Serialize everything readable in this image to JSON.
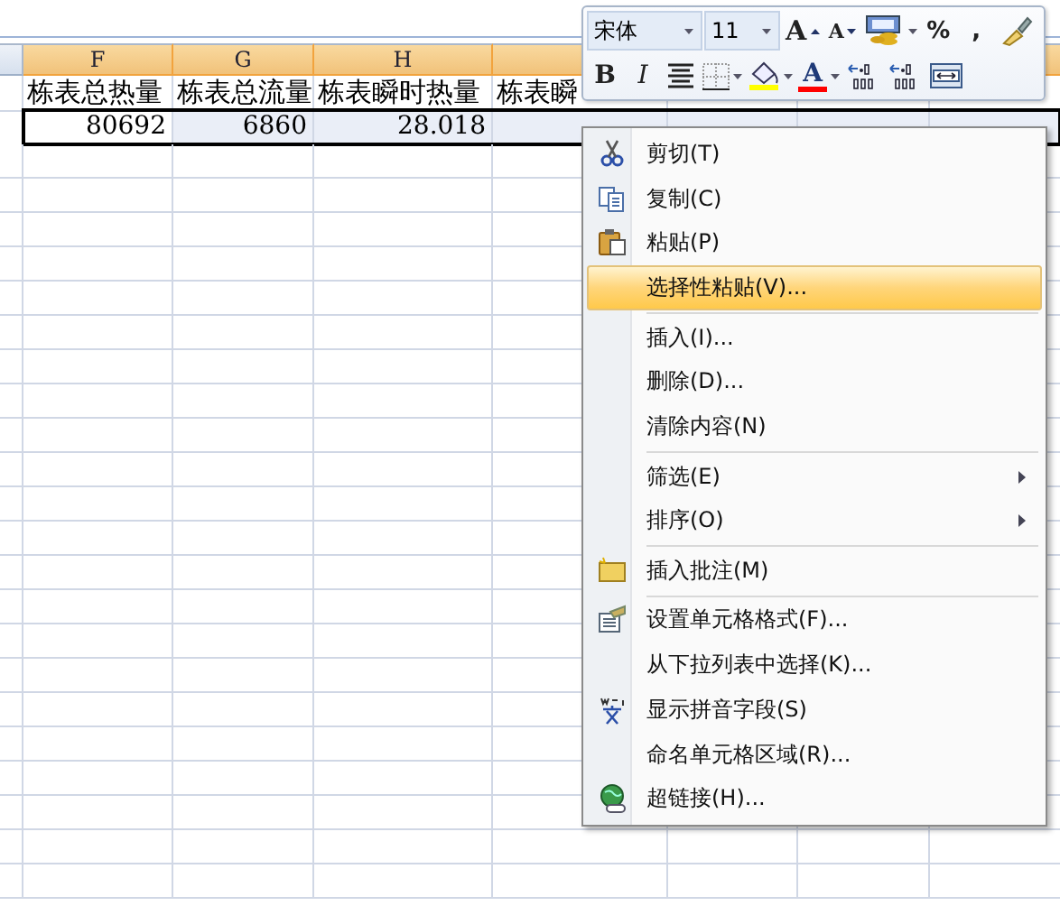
{
  "sheet": {
    "columns": [
      {
        "selected": false
      },
      {
        "letter": "F",
        "selected": true
      },
      {
        "letter": "G",
        "selected": true
      },
      {
        "letter": "H",
        "selected": true
      },
      {
        "selected": true
      },
      {
        "selected": true
      }
    ],
    "rows": [
      [
        null,
        "栋表总热量",
        "栋表总流量",
        "栋表瞬时热量",
        "栋表瞬",
        null
      ],
      [
        null,
        "80692",
        "6860",
        "28.018",
        null,
        null
      ]
    ]
  },
  "mini_toolbar": {
    "rows": [
      [
        {
          "kind": "font-field",
          "value": "宋体"
        },
        {
          "kind": "size-field",
          "value": "11"
        },
        {
          "kind": "grow",
          "label": "A"
        },
        {
          "kind": "shrink",
          "label": "A"
        },
        {
          "kind": "accounting"
        },
        {
          "kind": "char",
          "label": "%"
        },
        {
          "kind": "char",
          "label": ","
        },
        {
          "kind": "painter"
        }
      ],
      [
        {
          "kind": "bold",
          "label": "B"
        },
        {
          "kind": "italic",
          "label": "I"
        },
        {
          "kind": "align"
        },
        {
          "kind": "borders"
        },
        {
          "kind": "fill",
          "color": "#ffff00"
        },
        {
          "kind": "fontcolor",
          "label": "A",
          "color": "#ff0000"
        },
        {
          "kind": "incdec"
        },
        {
          "kind": "decdec"
        },
        {
          "kind": "merge"
        }
      ]
    ]
  },
  "context_menu": {
    "items": [
      {
        "label": "剪切(T)",
        "kind": "cut",
        "selected": false,
        "submenu": false,
        "separator_before": false
      },
      {
        "label": "复制(C)",
        "kind": "copy",
        "selected": false,
        "submenu": false,
        "separator_before": false
      },
      {
        "label": "粘贴(P)",
        "kind": "paste",
        "selected": false,
        "submenu": false,
        "separator_before": false
      },
      {
        "label": "选择性粘贴(V)...",
        "kind": "plain",
        "selected": true,
        "submenu": false,
        "separator_before": false
      },
      {
        "label": "插入(I)...",
        "kind": "plain",
        "selected": false,
        "submenu": false,
        "separator_before": true
      },
      {
        "label": "删除(D)...",
        "kind": "plain",
        "selected": false,
        "submenu": false,
        "separator_before": false
      },
      {
        "label": "清除内容(N)",
        "kind": "plain",
        "selected": false,
        "submenu": false,
        "separator_before": false
      },
      {
        "label": "筛选(E)",
        "kind": "plain",
        "selected": false,
        "submenu": true,
        "separator_before": true
      },
      {
        "label": "排序(O)",
        "kind": "plain",
        "selected": false,
        "submenu": true,
        "separator_before": false
      },
      {
        "label": "插入批注(M)",
        "kind": "comment",
        "selected": false,
        "submenu": false,
        "separator_before": true
      },
      {
        "label": "设置单元格格式(F)...",
        "kind": "format",
        "selected": false,
        "submenu": false,
        "separator_before": true
      },
      {
        "label": "从下拉列表中选择(K)...",
        "kind": "plain",
        "selected": false,
        "submenu": false,
        "separator_before": false
      },
      {
        "label": "显示拼音字段(S)",
        "kind": "phonetic",
        "selected": false,
        "submenu": false,
        "separator_before": false
      },
      {
        "label": "命名单元格区域(R)...",
        "kind": "plain",
        "selected": false,
        "submenu": false,
        "separator_before": false
      },
      {
        "label": "超链接(H)...",
        "kind": "link",
        "selected": false,
        "submenu": false,
        "separator_before": false
      }
    ]
  }
}
